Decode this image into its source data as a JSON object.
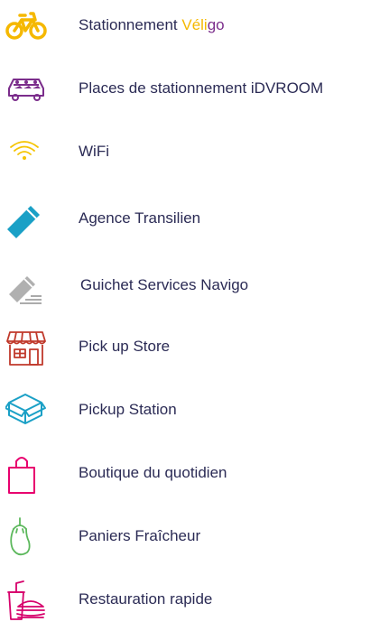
{
  "colors": {
    "text": "#2b2b55",
    "velo": "#f5b800",
    "idvroom": "#7b2d8b",
    "wifi": "#f5c400",
    "agence": "#1aa0c6",
    "guichet": "#a0a0a0",
    "store": "#c0392b",
    "pickup_station": "#1aa0c6",
    "boutique": "#e8006e",
    "paniers": "#5cb85c",
    "restauration": "#d6006b"
  },
  "services": [
    {
      "label_prefix": "Stationnement ",
      "brand_part1": "Véli",
      "brand_part2": "go",
      "icon": "bicycle-icon"
    },
    {
      "label": "Places de stationnement iDVROOM",
      "icon": "carpool-icon"
    },
    {
      "label": "WiFi",
      "icon": "wifi-icon"
    },
    {
      "label": "Agence Transilien",
      "icon": "ticket-card-icon"
    },
    {
      "label": "Guichet Services Navigo",
      "icon": "card-slot-icon"
    },
    {
      "label": "Pick up Store",
      "icon": "storefront-icon"
    },
    {
      "label": "Pickup Station",
      "icon": "parcel-box-icon"
    },
    {
      "label": "Boutique du quotidien",
      "icon": "shopping-bag-icon"
    },
    {
      "label": "Paniers Fraîcheur",
      "icon": "eggplant-icon"
    },
    {
      "label": "Restauration rapide",
      "icon": "fast-food-icon"
    }
  ]
}
